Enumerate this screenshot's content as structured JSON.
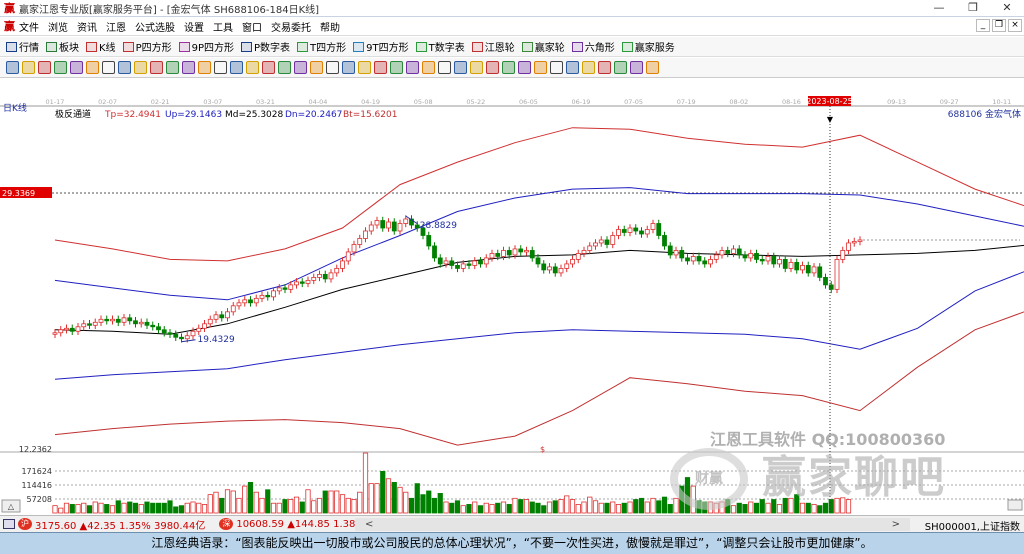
{
  "window": {
    "title": "赢家江恩专业版[赢家服务平台] - [金宏气体  SH688106-184日K线]",
    "min": "—",
    "max": "❐",
    "close": "✕"
  },
  "menu": [
    "文件",
    "浏览",
    "资讯",
    "江恩",
    "公式选股",
    "设置",
    "工具",
    "窗口",
    "交易委托",
    "帮助"
  ],
  "toolbar1": [
    {
      "label": "行情",
      "icon": "quote-grid-icon",
      "color": "#1a3d8a"
    },
    {
      "label": "板块",
      "icon": "sector-blocks-icon",
      "color": "#2a7a3a"
    },
    {
      "label": "K线",
      "icon": "candlestick-icon",
      "color": "#c03030"
    },
    {
      "label": "P四方形",
      "icon": "p-square-icon",
      "color": "#c03030"
    },
    {
      "label": "9P四方形",
      "icon": "9p-square-icon",
      "color": "#a030a0"
    },
    {
      "label": "P数字表",
      "icon": "p-number-table-icon",
      "color": "#1a3d8a"
    },
    {
      "label": "T四方形",
      "icon": "t-square-icon",
      "color": "#2a9a3a"
    },
    {
      "label": "9T四方形",
      "icon": "9t-square-icon",
      "color": "#2080c0"
    },
    {
      "label": "T数字表",
      "icon": "t-number-table-icon",
      "color": "#2a9a3a"
    },
    {
      "label": "江恩轮",
      "icon": "gann-wheel-icon",
      "color": "#c03030"
    },
    {
      "label": "赢家轮",
      "icon": "winner-wheel-icon",
      "color": "#3a8a3a"
    },
    {
      "label": "六角形",
      "icon": "hexagon-icon",
      "color": "#7030a0"
    },
    {
      "label": "赢家服务",
      "icon": "dollar-icon",
      "color": "#2a9a3a"
    }
  ],
  "toolbar2_icons": [
    "cursor-icon",
    "zoom-in-icon",
    "zoom-out-icon",
    "period-icon",
    "pan-left-icon",
    "pan-right-icon",
    "arrow-up-icon",
    "arrow-down-icon",
    "draw-line-icon",
    "indicator-icon",
    "first-bar-icon",
    "prev-bar-icon",
    "next-bar-icon",
    "last-bar-icon",
    "diamond-1-icon",
    "diamond-2-icon",
    "diamond-3-icon",
    "diamond-4-icon",
    "diamond-5-icon",
    "diamond-6-icon",
    "diamond-7-icon",
    "hand-icon",
    "crosshair-icon",
    "angle-icon",
    "fan-icon",
    "text-icon",
    "calendar-icon",
    "calculator-icon",
    "report-icon",
    "save-icon",
    "network-icon",
    "trade-icon",
    "fibonacci-icon",
    "ratio-icon",
    "line-tool-icon",
    "circle-tool-icon",
    "arc-tool-icon",
    "pen-icon",
    "eraser-icon",
    "color-icon",
    "infinity-icon"
  ],
  "chart": {
    "period_label": "日K线",
    "indicator_name": "极反通道",
    "indicator_values": {
      "tp": "Tp=32.4941",
      "up": "Up=29.1463",
      "md": "Md=25.3028",
      "dn": "Dn=20.2467",
      "bt": "Bt=15.6201"
    },
    "stock": "688106  金宏气体",
    "date_ticks": [
      "01-17",
      "02-07",
      "02-21",
      "03-07",
      "03-21",
      "04-04",
      "04-19",
      "05-08",
      "05-22",
      "06-05",
      "06-19",
      "07-05",
      "07-19",
      "08-02",
      "08-16",
      "2023-08-25",
      "09-13",
      "09-27",
      "10-11"
    ],
    "cursor_date": "2023-08-25",
    "price_marker": "29.3369",
    "price_bottom": "12.2362",
    "high_label": "28.8829",
    "low_label": "19.4329",
    "signal_label": "$",
    "volume_ticks": [
      "171624",
      "114416",
      "57208"
    ],
    "colors": {
      "up": "#e03030",
      "down": "#008000",
      "tp": "#d03030",
      "up_band": "#2020c0",
      "md": "#000000",
      "dn": "#2020c0",
      "bt": "#c03030"
    }
  },
  "chart_data": {
    "type": "candlestick",
    "price_axis": [
      12.2362,
      29.3369
    ],
    "closes": [
      20.0,
      20.2,
      20.3,
      20.1,
      20.4,
      20.6,
      20.5,
      20.7,
      20.9,
      20.8,
      20.9,
      20.7,
      21.0,
      20.8,
      20.6,
      20.7,
      20.5,
      20.4,
      20.2,
      20.0,
      19.9,
      19.7,
      19.6,
      19.8,
      20.1,
      20.3,
      20.6,
      20.9,
      21.2,
      21.0,
      21.4,
      21.8,
      22.0,
      22.2,
      22.0,
      22.3,
      22.5,
      22.4,
      22.8,
      23.0,
      22.9,
      23.2,
      23.4,
      23.3,
      23.5,
      23.7,
      23.9,
      23.6,
      24.0,
      24.3,
      24.8,
      25.4,
      25.9,
      26.3,
      26.8,
      27.2,
      27.5,
      27.0,
      27.4,
      26.8,
      27.3,
      27.6,
      27.2,
      27.0,
      26.5,
      25.8,
      25.0,
      24.6,
      24.8,
      24.5,
      24.3,
      24.6,
      24.5,
      24.8,
      24.6,
      25.0,
      25.3,
      25.1,
      25.5,
      25.2,
      25.6,
      25.4,
      25.5,
      25.0,
      24.6,
      24.2,
      24.4,
      24.0,
      24.3,
      24.6,
      24.9,
      25.3,
      25.5,
      25.8,
      26.0,
      26.2,
      25.9,
      26.5,
      26.9,
      26.7,
      27.0,
      26.8,
      26.6,
      26.9,
      27.3,
      26.5,
      25.8,
      25.2,
      25.5,
      25.0,
      24.8,
      25.1,
      24.8,
      24.6,
      24.9,
      25.2,
      25.5,
      25.3,
      25.6,
      25.2,
      25.0,
      25.3,
      24.9,
      24.8,
      25.1,
      24.6,
      24.9,
      24.3,
      24.7,
      24.2,
      24.5,
      24.0,
      24.4,
      23.7,
      23.2,
      22.9,
      24.9,
      25.5,
      26.0,
      26.1,
      26.2
    ],
    "volumes": [
      30000,
      20000,
      40000,
      35000,
      35000,
      40000,
      30000,
      45000,
      40000,
      35000,
      30000,
      50000,
      40000,
      45000,
      40000,
      35000,
      45000,
      40000,
      40000,
      40000,
      50000,
      25000,
      30000,
      40000,
      45000,
      40000,
      35000,
      75000,
      85000,
      60000,
      95000,
      90000,
      60000,
      110000,
      125000,
      85000,
      60000,
      95000,
      40000,
      40000,
      55000,
      55000,
      65000,
      45000,
      95000,
      50000,
      60000,
      90000,
      90000,
      90000,
      75000,
      60000,
      55000,
      85000,
      245000,
      120000,
      120000,
      170000,
      140000,
      125000,
      105000,
      85000,
      60000,
      120000,
      75000,
      90000,
      60000,
      80000,
      45000,
      40000,
      50000,
      30000,
      35000,
      45000,
      30000,
      40000,
      35000,
      40000,
      45000,
      35000,
      60000,
      55000,
      55000,
      45000,
      40000,
      30000,
      45000,
      50000,
      55000,
      70000,
      55000,
      35000,
      45000,
      65000,
      50000,
      40000,
      40000,
      45000,
      35000,
      40000,
      45000,
      55000,
      60000,
      45000,
      60000,
      50000,
      65000,
      35000,
      60000,
      110000,
      145000,
      110000,
      50000,
      45000,
      45000,
      40000,
      45000,
      55000,
      30000,
      40000,
      35000,
      45000,
      40000,
      55000,
      40000,
      55000,
      35000,
      60000,
      60000,
      75000,
      40000,
      40000,
      35000,
      30000,
      40000,
      55000,
      60000,
      62000,
      55000
    ],
    "bands": {
      "step_bars": 10,
      "Tp": [
        26.2,
        25.6,
        24.9,
        24.8,
        25.6,
        27.0,
        29.9,
        31.4,
        32.7,
        33.7,
        33.6,
        33.0,
        32.6,
        32.4,
        33.2,
        31.4,
        29.6,
        28.3
      ],
      "Up": [
        23.5,
        23.0,
        22.5,
        22.2,
        23.2,
        25.0,
        26.5,
        28.1,
        29.0,
        29.6,
        29.7,
        29.3,
        29.3,
        29.3,
        29.2,
        28.6,
        27.8,
        27.0
      ],
      "Md": [
        20.2,
        20.1,
        19.9,
        20.6,
        21.7,
        22.9,
        23.8,
        24.7,
        25.1,
        25.2,
        25.5,
        25.3,
        25.2,
        25.1,
        25.2,
        25.3,
        25.5,
        25.9
      ],
      "Dn": [
        16.9,
        17.2,
        17.4,
        17.6,
        18.2,
        18.7,
        19.2,
        19.6,
        20.0,
        20.2,
        20.1,
        20.0,
        19.9,
        19.6,
        18.9,
        20.3,
        22.8,
        24.3
      ],
      "Bt": [
        13.2,
        13.6,
        13.9,
        14.1,
        14.2,
        14.0,
        13.6,
        12.5,
        13.1,
        14.8,
        17.0,
        16.6,
        16.1,
        15.8,
        14.8,
        17.7,
        20.2,
        21.6
      ]
    }
  },
  "watermark": {
    "line1": "江恩工具软件  QQ:100800360",
    "line2": "赢家聊吧",
    "logo": "财赢"
  },
  "status": {
    "sh_icon": "沪",
    "sh": "3175.60 ▲42.35 1.35% 3980.44亿",
    "sz_icon": "深",
    "sz": "10608.59 ▲144.85 1.38% 4715.74",
    "scroll_left": "<",
    "scroll_right": ">",
    "index": "SH000001,上证指数"
  },
  "quote": "江恩经典语录：“图表能反映出一切股市或公司股民的总体心理状况”，“不要一次性买进，傲慢就是罪过”，“调整只会让股市更加健康”。"
}
